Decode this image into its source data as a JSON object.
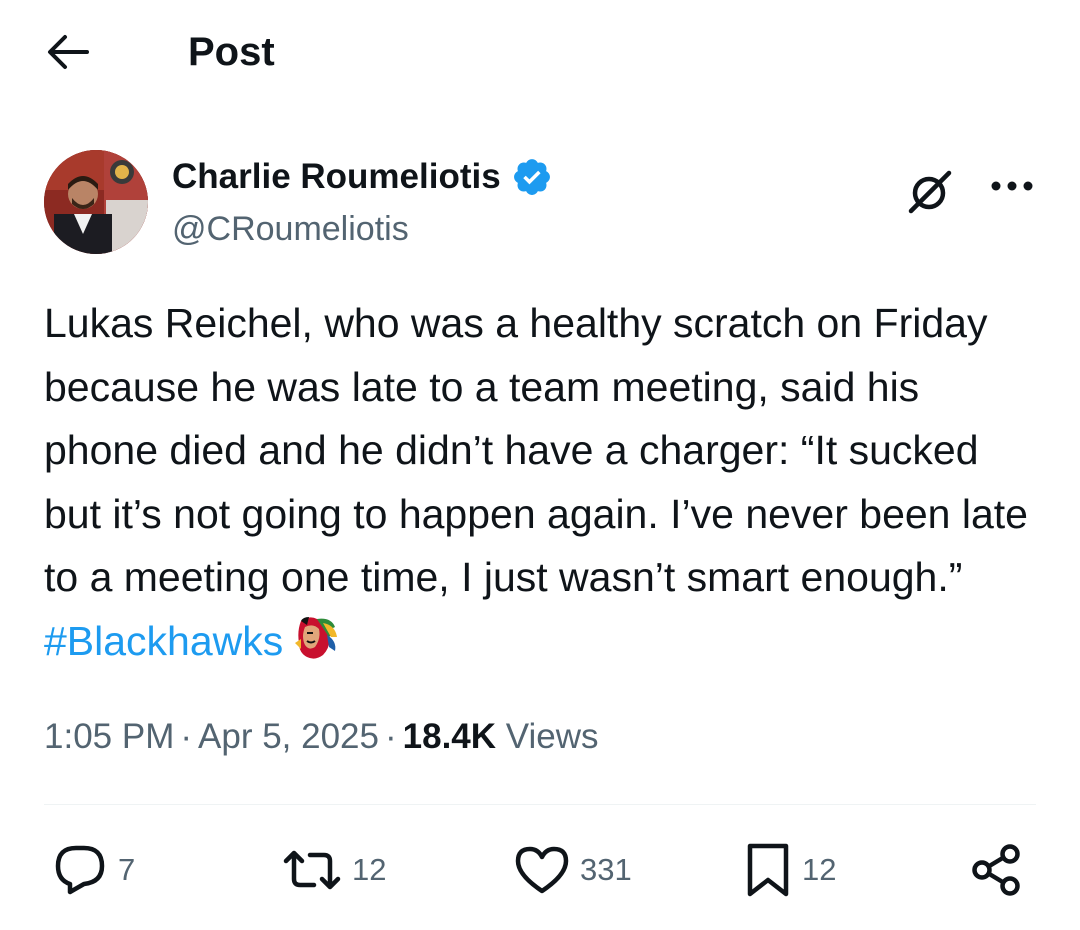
{
  "header": {
    "title": "Post"
  },
  "author": {
    "display_name": "Charlie Roumeliotis",
    "handle": "@CRoumeliotis",
    "verified": true
  },
  "tweet": {
    "text": "Lukas Reichel, who was a healthy scratch on Friday because he was late to a team meeting, said his phone died and he didn’t have a charger: “It sucked but it’s not going to happen again. I’ve never been late to a meeting one time, I just wasn’t smart enough.” ",
    "hashtag": "#Blackhawks",
    "emoji": "blackhawks-logo-icon"
  },
  "meta": {
    "time": "1:05 PM",
    "separator": "·",
    "date": "Apr 5, 2025",
    "views_count": "18.4K",
    "views_label": "Views"
  },
  "actions": {
    "replies": "7",
    "reposts": "12",
    "likes": "331",
    "bookmarks": "12"
  },
  "colors": {
    "text": "#0f1419",
    "secondary": "#536471",
    "link": "#1d9bf0",
    "verified": "#1d9bf0",
    "divider": "#eff3f4"
  }
}
